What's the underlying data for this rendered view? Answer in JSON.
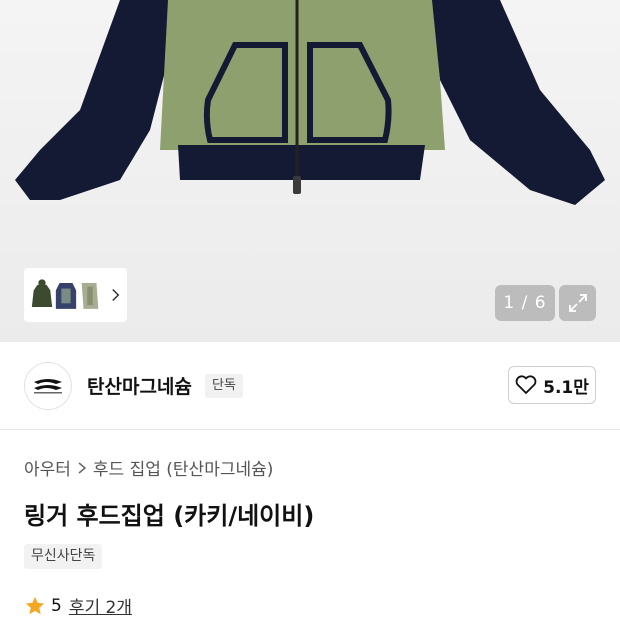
{
  "gallery": {
    "counter": "1 / 6",
    "colors": {
      "khaki": "#8ea06e",
      "navy": "#141a33",
      "background": "#eeeeee"
    }
  },
  "brand": {
    "name": "탄산마그네슘",
    "badge": "단독",
    "likes": "5.1만"
  },
  "product": {
    "breadcrumb": [
      "아우터",
      "후드 집업 (탄산마그네슘)"
    ],
    "title": "링거 후드집업 (카키/네이비)",
    "tag": "무신사단독",
    "rating": "5",
    "review_link": "후기 2개",
    "star_color": "#f5a623"
  }
}
